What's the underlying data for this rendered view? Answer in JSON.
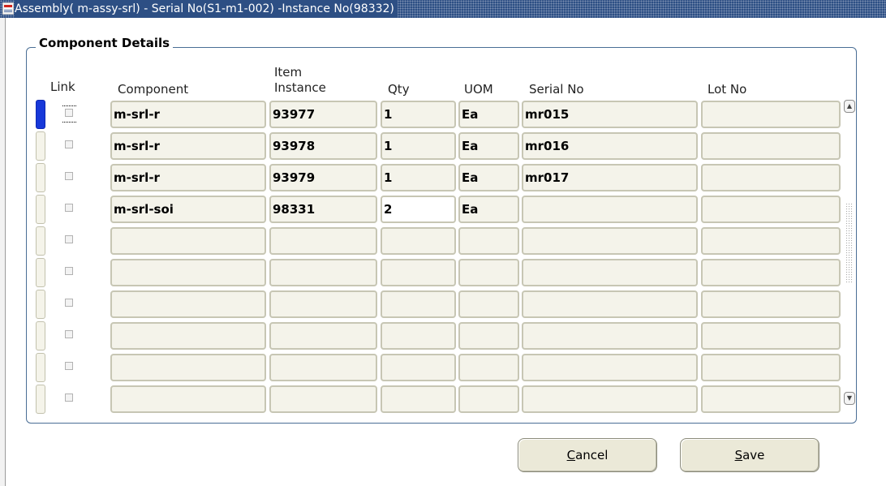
{
  "window": {
    "title": "Assembly( m-assy-srl) - Serial No(S1-m1-002) -Instance No(98332)"
  },
  "section": {
    "title": "Component Details"
  },
  "headers": {
    "link": "Link",
    "component": "Component",
    "item_instance_line1": "Item",
    "item_instance_line2": "Instance",
    "qty": "Qty",
    "uom": "UOM",
    "serial_no": "Serial No",
    "lot_no": "Lot No"
  },
  "rows": [
    {
      "component": "m-srl-r",
      "item_instance": "93977",
      "qty": "1",
      "uom": "Ea",
      "serial_no": "mr015",
      "lot_no": "",
      "linked": false,
      "current": true
    },
    {
      "component": "m-srl-r",
      "item_instance": "93978",
      "qty": "1",
      "uom": "Ea",
      "serial_no": "mr016",
      "lot_no": "",
      "linked": false,
      "current": false
    },
    {
      "component": "m-srl-r",
      "item_instance": "93979",
      "qty": "1",
      "uom": "Ea",
      "serial_no": "mr017",
      "lot_no": "",
      "linked": false,
      "current": false
    },
    {
      "component": "m-srl-soi",
      "item_instance": "98331",
      "qty": "2",
      "uom": "Ea",
      "serial_no": "",
      "lot_no": "",
      "linked": false,
      "current": false
    },
    {
      "component": "",
      "item_instance": "",
      "qty": "",
      "uom": "",
      "serial_no": "",
      "lot_no": "",
      "linked": false,
      "current": false
    },
    {
      "component": "",
      "item_instance": "",
      "qty": "",
      "uom": "",
      "serial_no": "",
      "lot_no": "",
      "linked": false,
      "current": false
    },
    {
      "component": "",
      "item_instance": "",
      "qty": "",
      "uom": "",
      "serial_no": "",
      "lot_no": "",
      "linked": false,
      "current": false
    },
    {
      "component": "",
      "item_instance": "",
      "qty": "",
      "uom": "",
      "serial_no": "",
      "lot_no": "",
      "linked": false,
      "current": false
    },
    {
      "component": "",
      "item_instance": "",
      "qty": "",
      "uom": "",
      "serial_no": "",
      "lot_no": "",
      "linked": false,
      "current": false
    },
    {
      "component": "",
      "item_instance": "",
      "qty": "",
      "uom": "",
      "serial_no": "",
      "lot_no": "",
      "linked": false,
      "current": false
    }
  ],
  "scrollbar": {
    "up_icon": "arrow-up-icon",
    "down_icon": "arrow-down-icon"
  },
  "buttons": {
    "cancel_mnemonic": "C",
    "cancel_rest": "ancel",
    "save_mnemonic": "S",
    "save_rest": "ave"
  },
  "colors": {
    "titlebar": "#2d4f84",
    "current_record": "#1738d9",
    "field_background": "#f4f3ea",
    "panel_border": "#4a6e95"
  }
}
